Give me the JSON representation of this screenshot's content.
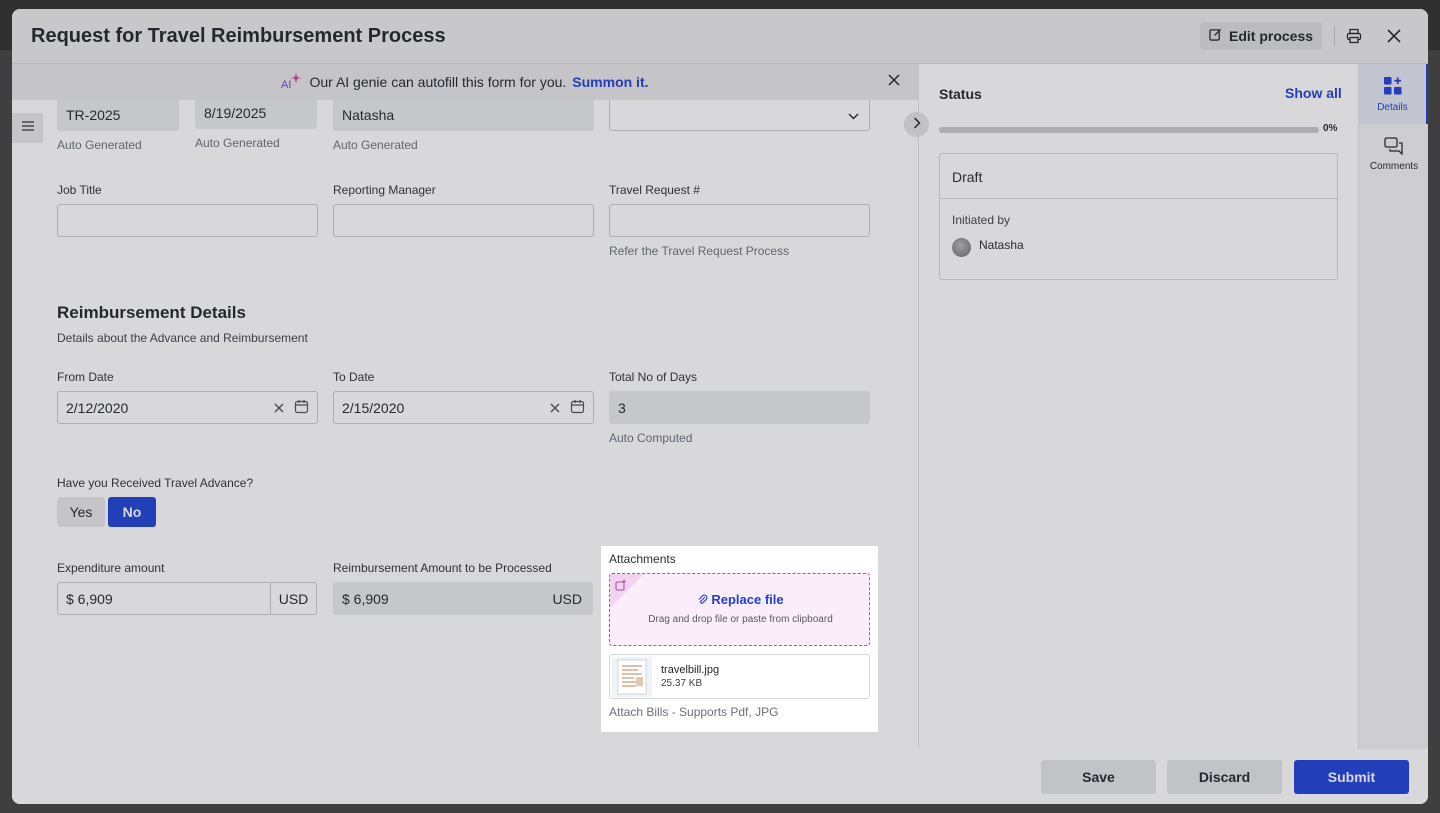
{
  "modal": {
    "title": "Request for Travel Reimbursement Process",
    "edit_label": "Edit process"
  },
  "banner": {
    "text": "Our AI genie can autofill this form for you.",
    "link": "Summon it."
  },
  "form": {
    "row1": {
      "id_value": "TR-2025",
      "id_hint": "Auto Generated",
      "date_value": "8/19/2025",
      "date_hint": "Auto Generated",
      "name_value": "Natasha",
      "name_hint": "Auto Generated"
    },
    "job_title": {
      "label": "Job Title",
      "value": ""
    },
    "reporting_manager": {
      "label": "Reporting Manager",
      "value": ""
    },
    "travel_request": {
      "label": "Travel Request #",
      "value": "",
      "hint": "Refer the Travel Request Process"
    },
    "section": {
      "title": "Reimbursement Details",
      "subtitle": "Details about the Advance and Reimbursement"
    },
    "from_date": {
      "label": "From Date",
      "value": "2/12/2020"
    },
    "to_date": {
      "label": "To Date",
      "value": "2/15/2020"
    },
    "total_days": {
      "label": "Total No of Days",
      "value": "3",
      "hint": "Auto Computed"
    },
    "advance": {
      "label": "Have you Received Travel Advance?",
      "yes": "Yes",
      "no": "No",
      "selected": "No"
    },
    "expenditure": {
      "label": "Expenditure amount",
      "value": "$ 6,909",
      "currency": "USD"
    },
    "reimbursement": {
      "label": "Reimbursement Amount to be Processed",
      "value": "$ 6,909",
      "currency": "USD"
    },
    "attachments": {
      "label": "Attachments",
      "replace": "Replace file",
      "drag_hint": "Drag and drop file or paste from clipboard",
      "file_name": "travelbill.jpg",
      "file_size": "25.37 KB",
      "hint": "Attach Bills - Supports Pdf, JPG"
    }
  },
  "status": {
    "title": "Status",
    "show_all": "Show all",
    "progress_pct": 0,
    "progress_label": "0%",
    "stage": "Draft",
    "initiated_by_label": "Initiated by",
    "initiated_by": "Natasha"
  },
  "rail": {
    "details": "Details",
    "comments": "Comments"
  },
  "footer": {
    "save": "Save",
    "discard": "Discard",
    "submit": "Submit"
  },
  "colors": {
    "accent": "#1d3fd6",
    "attachment_border": "#b14fb0"
  }
}
